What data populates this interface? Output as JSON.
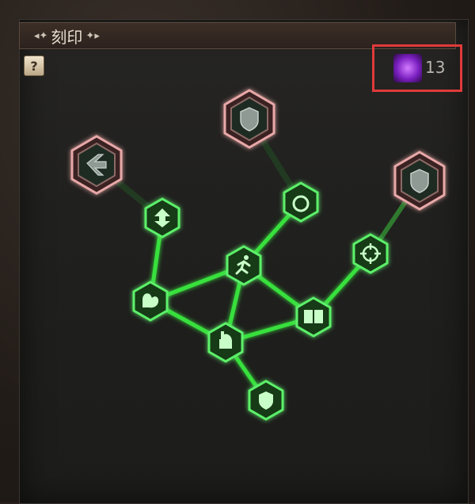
{
  "title": "刻印",
  "help_label": "?",
  "currency": {
    "icon": "purple-crystal-icon",
    "count": "13"
  },
  "colors": {
    "link": "#37d93a",
    "node_border": "#5df06a",
    "legendary_border": "#e5a4a4"
  },
  "nodes": [
    {
      "id": "top-shield",
      "icon": "shield-icon",
      "tier": "legendary",
      "active": false
    },
    {
      "id": "left-arrow",
      "icon": "arrow-slash-icon",
      "tier": "legendary",
      "active": false
    },
    {
      "id": "right-shield",
      "icon": "shield-icon",
      "tier": "legendary",
      "active": false
    },
    {
      "id": "up-arrows",
      "icon": "up-arrows-icon",
      "tier": "normal",
      "active": true
    },
    {
      "id": "swirl",
      "icon": "swirl-icon",
      "tier": "normal",
      "active": true
    },
    {
      "id": "crosshair",
      "icon": "crosshair-icon",
      "tier": "normal",
      "active": true
    },
    {
      "id": "runner",
      "icon": "runner-icon",
      "tier": "normal",
      "active": true
    },
    {
      "id": "flex",
      "icon": "flex-arm-icon",
      "tier": "normal",
      "active": true
    },
    {
      "id": "book",
      "icon": "book-icon",
      "tier": "normal",
      "active": true
    },
    {
      "id": "fist",
      "icon": "fist-icon",
      "tier": "normal",
      "active": true
    },
    {
      "id": "bottom-shield",
      "icon": "shield-icon",
      "tier": "normal",
      "active": true
    }
  ]
}
